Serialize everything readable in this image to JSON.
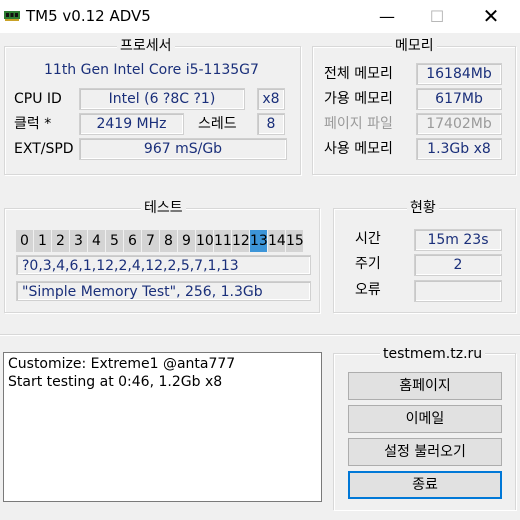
{
  "window": {
    "title": "TM5 v0.12 ADV5",
    "minimize_glyph": "—",
    "maximize_glyph": "☐",
    "close_glyph": "✕"
  },
  "processor": {
    "title": "프로세서",
    "cpu_name": "11th Gen Intel Core i5-1135G7",
    "cpu_id_label": "CPU ID",
    "cpu_id_value": "Intel  (6 ?8C ?1)",
    "cpu_id_mult": "x8",
    "clock_label": "클럭 *",
    "clock_value": "2419 MHz",
    "thread_label": "스레드",
    "thread_value": "8",
    "extspd_label": "EXT/SPD",
    "extspd_value": "967 mS/Gb"
  },
  "memory": {
    "title": "메모리",
    "total_label": "전체 메모리",
    "total_value": "16184Mb",
    "avail_label": "가용 메모리",
    "avail_value": "617Mb",
    "pagefile_label": "페이지 파일",
    "pagefile_value": "17402Mb",
    "used_label": "사용 메모리",
    "used_value": "1.3Gb x8"
  },
  "test": {
    "title": "테스트",
    "cells": [
      "0",
      "1",
      "2",
      "3",
      "4",
      "5",
      "6",
      "7",
      "8",
      "9",
      "10",
      "11",
      "12",
      "13",
      "14",
      "15"
    ],
    "active_index": 13,
    "sequence": "?0,3,4,6,1,12,2,4,12,2,5,7,1,13",
    "config": "\"Simple Memory Test\", 256, 1.3Gb"
  },
  "status": {
    "title": "현황",
    "time_label": "시간",
    "time_value": "15m 23s",
    "cycle_label": "주기",
    "cycle_value": "2",
    "error_label": "오류",
    "error_value": ""
  },
  "log": {
    "lines": [
      "Customize: Extreme1 @anta777",
      "Start testing at 0:46, 1.2Gb x8"
    ]
  },
  "side": {
    "title": "testmem.tz.ru",
    "homepage_label": "홈페이지",
    "email_label": "이메일",
    "load_settings_label": "설정 불러오기",
    "exit_label": "종료"
  },
  "colors": {
    "accent": "#0078d7",
    "active_cell": "#3d95d8",
    "value_text": "#1a2f7a"
  },
  "icons": {
    "app": "memory-chip-icon"
  }
}
